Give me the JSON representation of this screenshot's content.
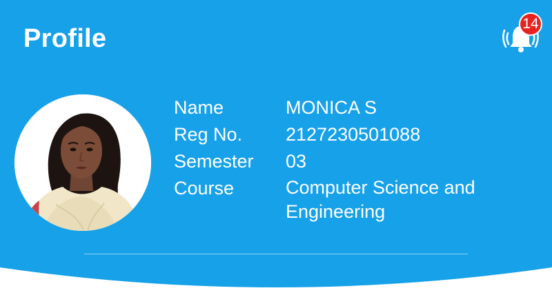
{
  "header": {
    "title": "Profile",
    "notifications": {
      "icon": "bell-icon",
      "count": "14",
      "badge_color": "#e8231f"
    }
  },
  "profile": {
    "avatar_icon": "profile-photo",
    "fields": [
      {
        "label": "Name",
        "value": "MONICA S"
      },
      {
        "label": "Reg No.",
        "value": "2127230501088"
      },
      {
        "label": "Semester",
        "value": "03"
      },
      {
        "label": "Course",
        "value": "Computer Science and Engineering"
      }
    ]
  },
  "colors": {
    "background": "#17a1e8",
    "text": "#ffffff",
    "card": "#ffffff"
  }
}
